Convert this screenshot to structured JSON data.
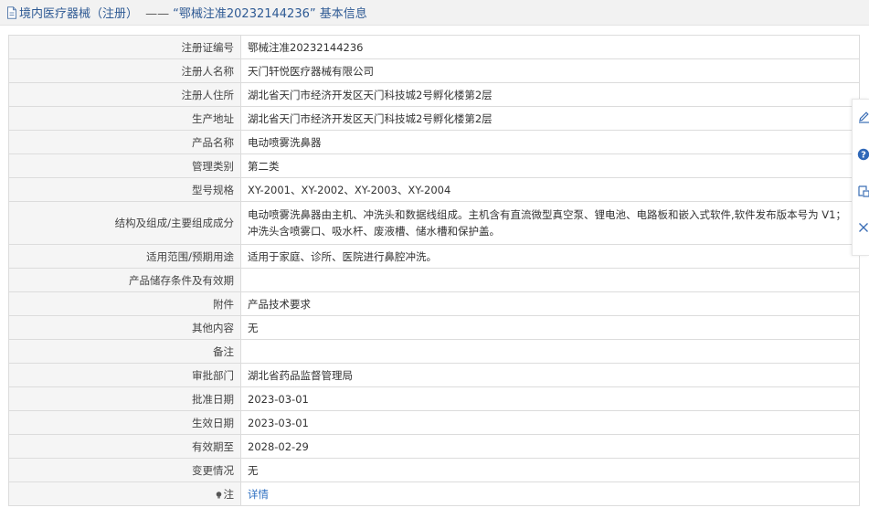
{
  "header": {
    "category": "境内医疗器械（注册）",
    "separator": "——",
    "title_quoted": "“鄂械注准20232144236”",
    "title_suffix": "基本信息"
  },
  "rows": [
    {
      "label": "注册证编号",
      "value": "鄂械注准20232144236"
    },
    {
      "label": "注册人名称",
      "value": "天门轩悦医疗器械有限公司"
    },
    {
      "label": "注册人住所",
      "value": "湖北省天门市经济开发区天门科技城2号孵化楼第2层"
    },
    {
      "label": "生产地址",
      "value": "湖北省天门市经济开发区天门科技城2号孵化楼第2层"
    },
    {
      "label": "产品名称",
      "value": "电动喷雾洗鼻器"
    },
    {
      "label": "管理类别",
      "value": "第二类"
    },
    {
      "label": "型号规格",
      "value": "XY-2001、XY-2002、XY-2003、XY-2004"
    },
    {
      "label": "结构及组成/主要组成成分",
      "value": "电动喷雾洗鼻器由主机、冲洗头和数据线组成。主机含有直流微型真空泵、锂电池、电路板和嵌入式软件,软件发布版本号为 V1；冲洗头含喷雾口、吸水杆、废液槽、储水槽和保护盖。"
    },
    {
      "label": "适用范围/预期用途",
      "value": "适用于家庭、诊所、医院进行鼻腔冲洗。"
    },
    {
      "label": "产品储存条件及有效期",
      "value": ""
    },
    {
      "label": "附件",
      "value": "产品技术要求"
    },
    {
      "label": "其他内容",
      "value": "无"
    },
    {
      "label": "备注",
      "value": ""
    },
    {
      "label": "审批部门",
      "value": "湖北省药品监督管理局"
    },
    {
      "label": "批准日期",
      "value": "2023-03-01"
    },
    {
      "label": "生效日期",
      "value": "2023-03-01"
    },
    {
      "label": "有效期至",
      "value": "2028-02-29"
    },
    {
      "label": "变更情况",
      "value": "无"
    }
  ],
  "note_row": {
    "label": "注",
    "link": "详情"
  },
  "side_tools": [
    "edit-icon",
    "help-icon",
    "feedback-icon",
    "close-icon"
  ]
}
